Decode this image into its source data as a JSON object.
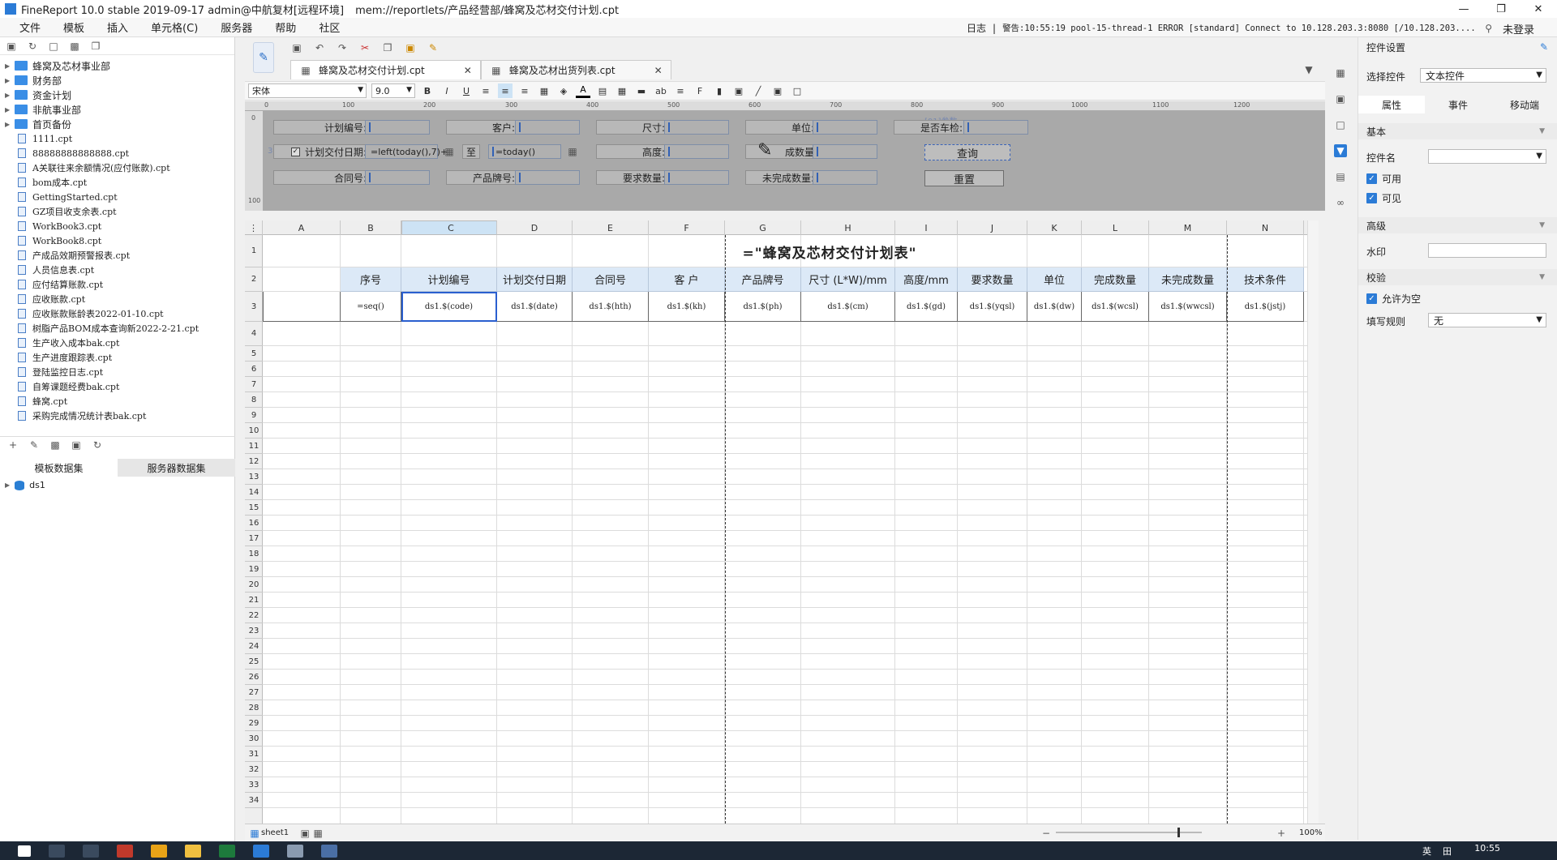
{
  "window": {
    "app_title": "FineReport 10.0 stable 2019-09-17 admin@中航复材[远程环境]",
    "file_path": "mem://reportlets/产品经营部/蜂窝及芯材交付计划.cpt",
    "min": "—",
    "max": "❐",
    "close": "✕"
  },
  "menu": {
    "items": [
      "文件",
      "模板",
      "插入",
      "单元格(C)",
      "服务器",
      "帮助",
      "社区"
    ],
    "log_label": "日志",
    "sep": "|",
    "warning_text": "警告:10:55:19 pool-15-thread-1 ERROR [standard] Connect to 10.128.203.3:8080 [/10.128.203....",
    "login": "未登录"
  },
  "tree": {
    "folders": [
      "蜂窝及芯材事业部",
      "财务部",
      "资金计划",
      "非航事业部",
      "首页备份"
    ],
    "files": [
      "1111.cpt",
      "88888888888888.cpt",
      "A关联往来余额情况(应付账款).cpt",
      "bom成本.cpt",
      "GettingStarted.cpt",
      "GZ项目收支余表.cpt",
      "WorkBook3.cpt",
      "WorkBook8.cpt",
      "产成品效期预警报表.cpt",
      "人员信息表.cpt",
      "应付结算账款.cpt",
      "应收账款.cpt",
      "应收账款账龄表2022-01-10.cpt",
      "树脂产品BOM成本查询新2022-2-21.cpt",
      "生产收入成本bak.cpt",
      "生产进度跟踪表.cpt",
      "登陆监控日志.cpt",
      "自筹课题经费bak.cpt",
      "蜂窝.cpt",
      "采购完成情况统计表bak.cpt"
    ]
  },
  "datasets": {
    "tab_template": "模板数据集",
    "tab_server": "服务器数据集",
    "item": "ds1"
  },
  "file_tabs": [
    "蜂窝及芯材交付计划.cpt",
    "蜂窝及芯材出货列表.cpt"
  ],
  "format": {
    "font": "宋体",
    "size": "9.0",
    "bold": "B",
    "italic": "I",
    "underline": "U"
  },
  "ruler": {
    "marks": [
      "0",
      "100",
      "200",
      "300",
      "400",
      "500",
      "600",
      "700",
      "800",
      "900",
      "1000",
      "1100",
      "1200"
    ],
    "v_marks": [
      "0",
      "100"
    ]
  },
  "params": {
    "labels": {
      "plan_no": "计划编号:",
      "customer": "客户:",
      "size": "尺寸:",
      "unit": "单位:",
      "car_check": "是否车检:",
      "plan_date": "计划交付日期:",
      "height": "高度:",
      "done_qty": "成数量",
      "contract": "合同号:",
      "grade": "产品牌号:",
      "req_qty": "要求数量:",
      "undone_qty": "未完成数量:"
    },
    "date_from": "=left(today(),7)+",
    "date_to": "=today()",
    "to": "至",
    "query_btn": "查询",
    "reset_btn": "重置",
    "ghost1": "[01]参数",
    "ghost2": "3个数"
  },
  "grid": {
    "columns": [
      "A",
      "B",
      "C",
      "D",
      "E",
      "F",
      "G",
      "H",
      "I",
      "J",
      "K",
      "L",
      "M",
      "N"
    ],
    "rows": [
      "1",
      "2",
      "3",
      "4",
      "5",
      "6",
      "7",
      "8",
      "9",
      "10",
      "11",
      "12",
      "13",
      "14",
      "15",
      "16",
      "17",
      "18",
      "19",
      "20",
      "21",
      "22",
      "23",
      "24",
      "25",
      "26",
      "27",
      "28",
      "29",
      "30",
      "31",
      "32",
      "33",
      "34"
    ],
    "title": "=\"蜂窝及芯材交付计划表\"",
    "headers": [
      "序号",
      "计划编号",
      "计划交付日期",
      "合同号",
      "客 户",
      "产品牌号",
      "尺寸 (L*W)/mm",
      "高度/mm",
      "要求数量",
      "单位",
      "完成数量",
      "未完成数量",
      "技术条件"
    ],
    "row3": [
      "=seq()",
      "ds1.$(code)",
      "ds1.$(date)",
      "ds1.$(hth)",
      "ds1.$(kh)",
      "ds1.$(ph)",
      "ds1.$(cm)",
      "ds1.$(gd)",
      "ds1.$(yqsl)",
      "ds1.$(dw)",
      "ds1.$(wcsl)",
      "ds1.$(wwcsl)",
      "ds1.$(jstj)"
    ]
  },
  "sheet": {
    "name": "sheet1",
    "zoom": "100%"
  },
  "right_panel": {
    "title": "控件设置",
    "select_label": "选择控件",
    "select_value": "文本控件",
    "tabs": [
      "属性",
      "事件",
      "移动端"
    ],
    "basic": "基本",
    "name_label": "控件名",
    "enabled": "可用",
    "visible": "可见",
    "advanced": "高级",
    "watermark": "水印",
    "validate": "校验",
    "allow_empty": "允许为空",
    "fill_rule_label": "填写规则",
    "fill_rule_value": "无"
  },
  "taskbar": {
    "time": "10:55",
    "lang": "英",
    "ime": "田"
  },
  "colors": {
    "accent": "#2b7bd6",
    "header_bg": "#dce9f7",
    "param_bg": "#a9a9a9"
  }
}
